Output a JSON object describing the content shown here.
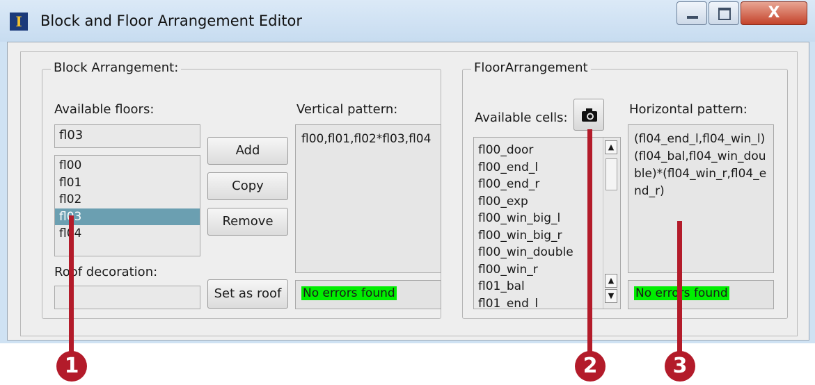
{
  "window": {
    "title": "Block and Floor Arrangement Editor",
    "close_glyph": "X"
  },
  "block": {
    "group_title": "Block Arrangement:",
    "available_floors_label": "Available floors:",
    "selected_floor_value": "fl03",
    "floors": [
      "fl00",
      "fl01",
      "fl02",
      "fl03",
      "fl04"
    ],
    "selected_index": 3,
    "vertical_pattern_label": "Vertical pattern:",
    "vertical_pattern_value": "fl00,fl01,fl02*fl03,fl04",
    "roof_decoration_label": "Roof decoration:",
    "roof_decoration_value": "",
    "buttons": {
      "add": "Add",
      "copy": "Copy",
      "remove": "Remove",
      "set_as_roof": "Set as roof"
    },
    "status": "No errors found"
  },
  "floor": {
    "group_title": "FloorArrangement",
    "available_cells_label": "Available cells:",
    "cells": [
      "fl00_door",
      "fl00_end_l",
      "fl00_end_r",
      "fl00_exp",
      "fl00_win_big_l",
      "fl00_win_big_r",
      "fl00_win_double",
      "fl00_win_r",
      "fl01_bal",
      "fl01_end_l"
    ],
    "horizontal_pattern_label": "Horizontal pattern:",
    "horizontal_pattern_value": "(fl04_end_l,fl04_win_l)\n(fl04_bal,fl04_win_double)*(fl04_win_r,fl04_end_r)",
    "status": "No errors found"
  },
  "callouts": [
    "1",
    "2",
    "3"
  ],
  "colors": {
    "callout": "#b31b2a",
    "selection": "#6b9fb1",
    "status_ok": "#00ee00"
  },
  "icons": {
    "camera": "camera-icon",
    "app": "app-icon"
  }
}
